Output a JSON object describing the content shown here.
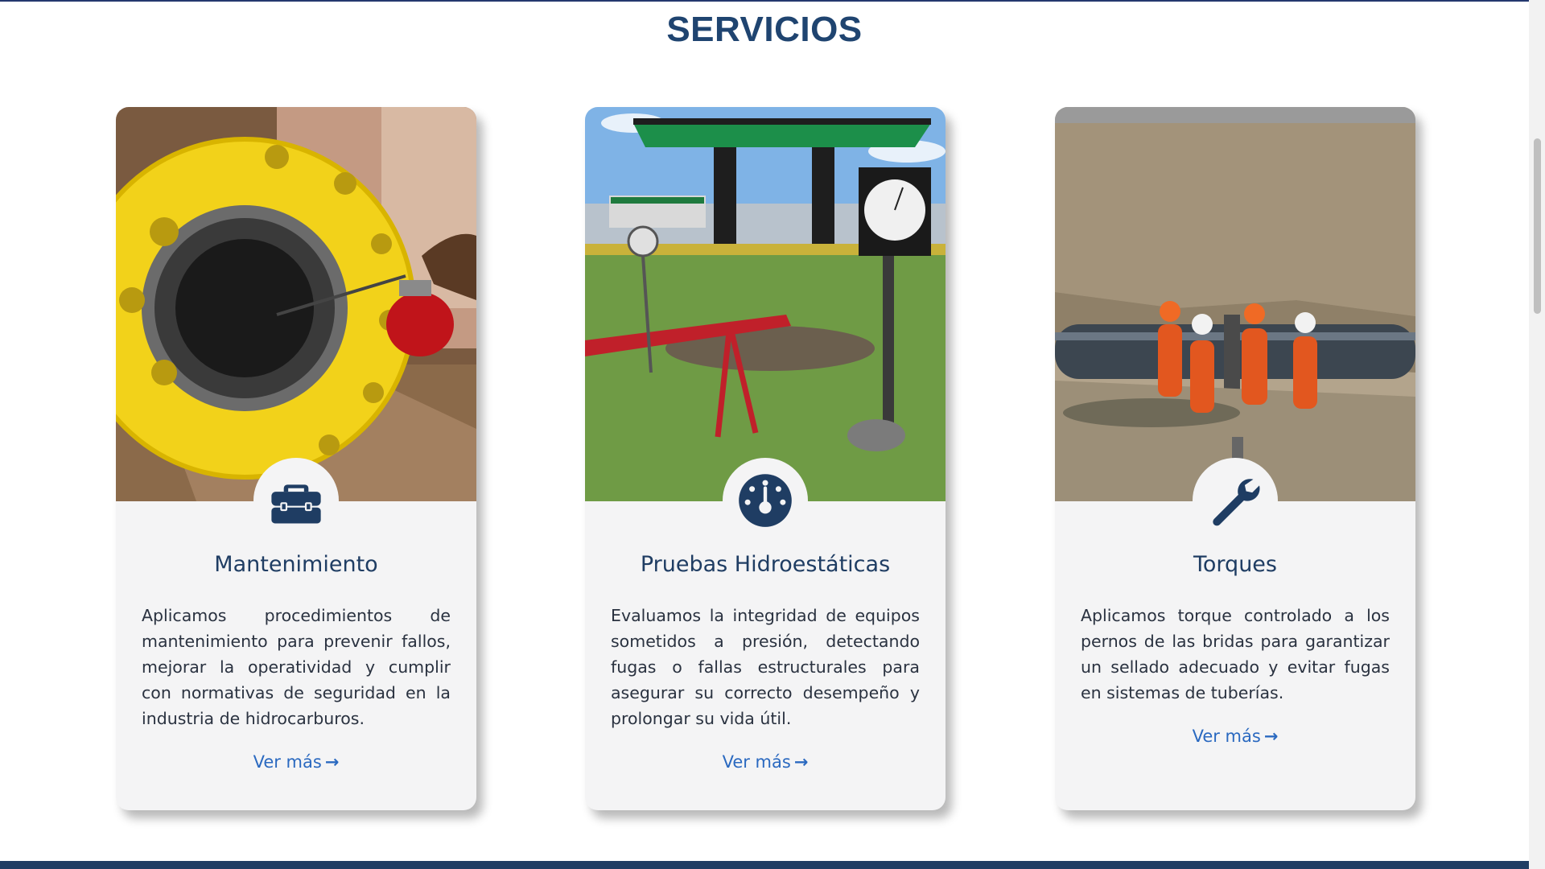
{
  "section": {
    "title": "SERVICIOS"
  },
  "services": [
    {
      "title": "Mantenimiento",
      "icon": "toolbox-icon",
      "description": "Aplicamos procedimientos de mantenimiento para prevenir fallos, mejorar la operatividad y cumplir con normativas de seguridad en la industria de hidrocarburos.",
      "link_label": "Ver más"
    },
    {
      "title": "Pruebas Hidroestáticas",
      "icon": "gauge-icon",
      "description": "Evaluamos la integridad de equipos sometidos a presión, detectando fugas o fallas estructurales para asegurar su correcto desempeño y prolongar su vida útil.",
      "link_label": "Ver más"
    },
    {
      "title": "Torques",
      "icon": "wrench-icon",
      "description": "Aplicamos torque controlado a los pernos de las bridas para garantizar un sellado adecuado y evitar fugas en sistemas de tuberías.",
      "link_label": "Ver más"
    }
  ],
  "colors": {
    "title": "#1f4470",
    "icon": "#1f3d63",
    "link": "#2a69c0",
    "card_background": "#f4f4f5",
    "footer_band": "#1f3d63"
  }
}
